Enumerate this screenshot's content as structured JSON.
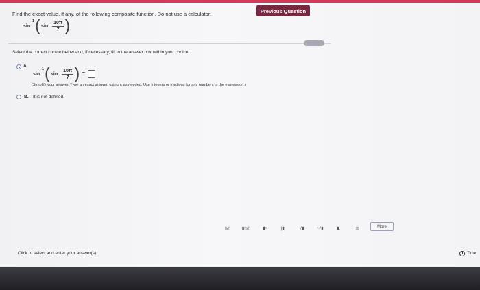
{
  "header": {
    "previous_question_label": "Previous Question"
  },
  "prompt": "Find the exact value, if any, of the following composite function. Do not use a calculator.",
  "expression": {
    "outer_fn": "sin",
    "outer_sup": "-1",
    "inner_fn": "sin",
    "numerator": "10π",
    "denominator": "7"
  },
  "divider_handle": "·····",
  "instruction": "Select the correct choice below and, if necessary, fill in the answer box within your choice.",
  "choices": {
    "a": {
      "letter": "A.",
      "selected": true,
      "equals": "=",
      "hint": "(Simplify your answer. Type an exact answer, using π as needed. Use integers or fractions for any numbers in the expression.)"
    },
    "b": {
      "letter": "B.",
      "text": "It is not defined.",
      "selected": false
    }
  },
  "toolbar": {
    "tools": [
      {
        "name": "fraction-tool",
        "label": "▯/▯"
      },
      {
        "name": "mixed-number-tool",
        "label": "▮▯/▯"
      },
      {
        "name": "exponent-tool",
        "label": "▮ⁿ"
      },
      {
        "name": "absolute-value-tool",
        "label": "|▮|"
      },
      {
        "name": "sqrt-tool",
        "label": "√▮"
      },
      {
        "name": "nth-root-tool",
        "label": "ⁿ√▮"
      },
      {
        "name": "decimal-tool",
        "label": "▮."
      },
      {
        "name": "pi-tool",
        "label": "π"
      }
    ],
    "more_label": "More"
  },
  "footer": {
    "instruction": "Click to select and enter your answer(s).",
    "time_label": "Time"
  }
}
